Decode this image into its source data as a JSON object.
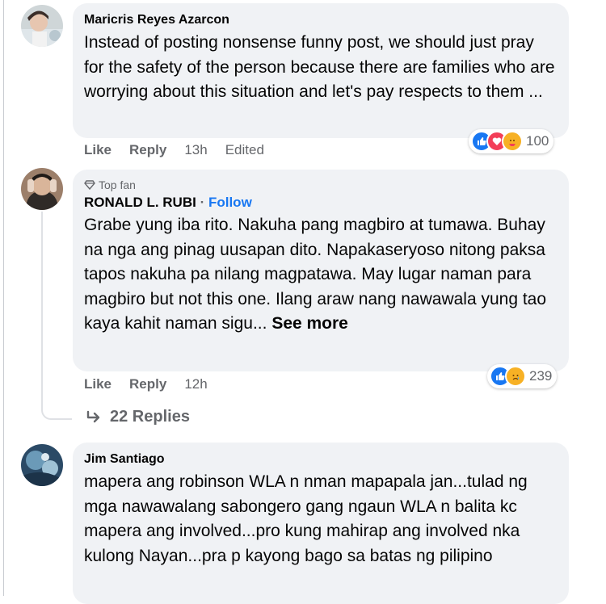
{
  "comments": [
    {
      "author": "Maricris Reyes Azarcon",
      "text": "Instead of posting nonsense funny post, we should just pray for the safety of the person because there are families who are worrying about this situation and let's pay respects to them ...",
      "like": "Like",
      "reply": "Reply",
      "time": "13h",
      "edited": "Edited",
      "reaction_count": "100",
      "reactions": [
        "like-icon",
        "love-icon",
        "care-icon"
      ]
    },
    {
      "badge": "Top fan",
      "author": "RONALD L. RUBI",
      "separator": "·",
      "follow": "Follow",
      "text": "Grabe yung iba rito. Nakuha pang magbiro at tumawa. Buhay na nga ang pinag uusapan dito. Napakaseryoso nitong paksa tapos nakuha pa nilang magpatawa. May lugar naman para magbiro but not this one. Ilang araw nang nawawala yung tao kaya kahit naman sigu...",
      "see_more": "See more",
      "like": "Like",
      "reply": "Reply",
      "time": "12h",
      "reaction_count": "239",
      "reactions": [
        "like-icon",
        "sad-icon"
      ],
      "replies_label": "22 Replies"
    },
    {
      "author": "Jim Santiago",
      "text": "mapera ang robinson WLA n nman mapapala jan...tulad ng mga nawawalang sabongero gang ngaun WLA n balita kc mapera ang involved...pro kung mahirap ang involved nka kulong Nayan...pra p kayong bago sa batas ng pilipino"
    }
  ],
  "colors": {
    "bubble": "#f0f2f5",
    "meta": "#65676b",
    "link": "#1877f2",
    "like": "#1877f2",
    "love": "#f33e58",
    "care": "#f7b125"
  }
}
